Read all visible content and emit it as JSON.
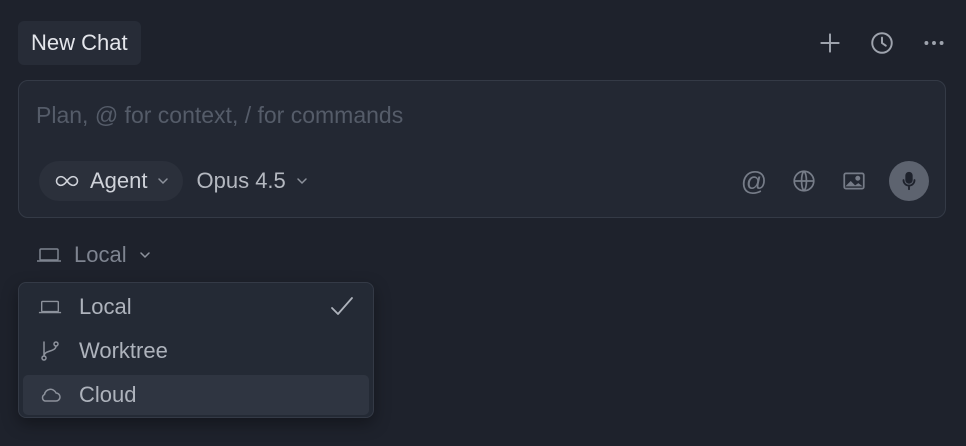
{
  "header": {
    "tab_title": "New Chat",
    "actions": [
      {
        "name": "new-chat-icon"
      },
      {
        "name": "history-icon"
      },
      {
        "name": "more-options-icon"
      }
    ]
  },
  "composer": {
    "placeholder": "Plan, @ for context, / for commands",
    "value": "",
    "mode": {
      "label": "Agent",
      "icon": "infinity-icon"
    },
    "model": {
      "label": "Opus 4.5"
    },
    "tools": {
      "mention_glyph": "@",
      "items": [
        "at-mention-icon",
        "globe-icon",
        "image-icon",
        "microphone-icon"
      ]
    }
  },
  "environment": {
    "selected_label": "Local",
    "icon": "laptop-icon"
  },
  "dropdown": {
    "items": [
      {
        "label": "Local",
        "icon": "laptop-icon",
        "selected": true
      },
      {
        "label": "Worktree",
        "icon": "branch-icon",
        "selected": false
      },
      {
        "label": "Cloud",
        "icon": "cloud-icon",
        "selected": false,
        "hovered": true
      }
    ]
  },
  "colors": {
    "background": "#1e222c",
    "panel": "#232833",
    "border": "#343a46",
    "hover": "#2f3541"
  }
}
